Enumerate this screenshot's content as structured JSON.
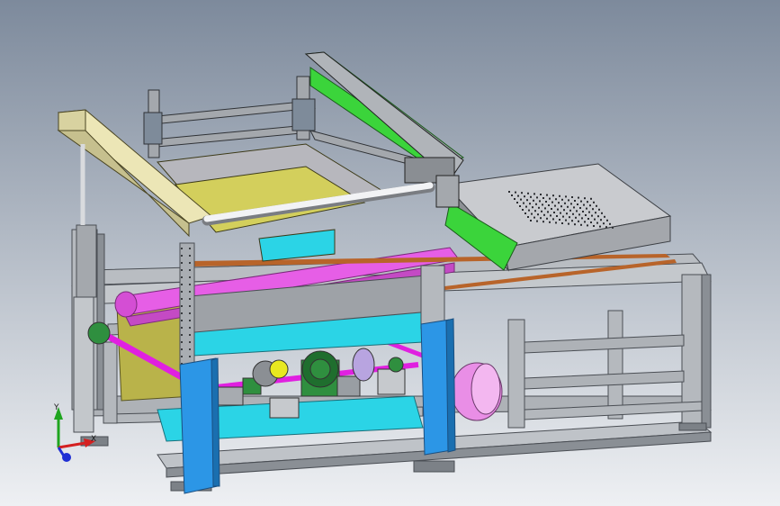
{
  "viewport": {
    "background_top": "#7d8a9c",
    "background_bottom": "#eef0f3"
  },
  "triad": {
    "x_label": "X",
    "y_label": "Y",
    "x_color": "#d42020",
    "y_color": "#1fa51f",
    "z_color": "#1f2fd4"
  },
  "colors": {
    "frame": "#b9bdc2",
    "frame_dark": "#8a8f95",
    "gantry_beam": "#ece6b6",
    "screen_frame": "#d3cf5c",
    "green_rail": "#3bd43b",
    "blue_post": "#2c96e6",
    "cyan_tray": "#2bd4e6",
    "magenta_belt": "#e65ee6",
    "magenta_shaft": "#e020e0",
    "pink_motor": "#e98ee6",
    "motor_green": "#208f3a",
    "copper_rail": "#b8642a",
    "table_top": "#c9cbcf",
    "olive_plate": "#b9b34a"
  }
}
